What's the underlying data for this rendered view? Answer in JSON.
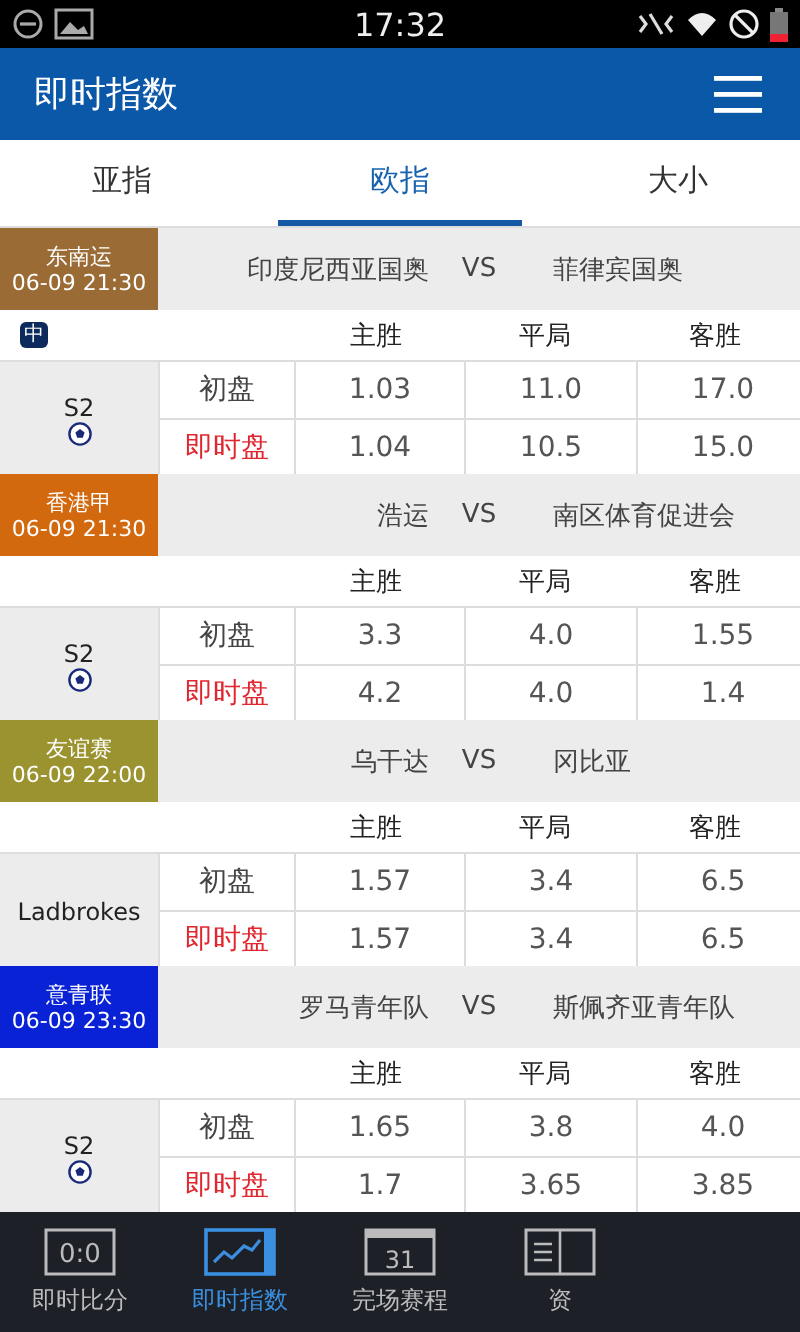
{
  "status_bar": {
    "time": "17:32"
  },
  "header": {
    "title": "即时指数"
  },
  "tabs": [
    {
      "label": "亚指",
      "selected": false
    },
    {
      "label": "欧指",
      "selected": true
    },
    {
      "label": "大小",
      "selected": false
    }
  ],
  "matches": [
    {
      "league": "东南运",
      "time": "06-09 21:30",
      "color": "#9a6b34",
      "home": "印度尼西亚国奥",
      "vs": "VS",
      "away": "菲律宾国奥",
      "badge": "中",
      "columns": [
        "主胜",
        "平局",
        "客胜"
      ],
      "bookmaker": {
        "name": "S2",
        "ball": true
      },
      "odds": [
        {
          "kind": "initial",
          "label": "初盘",
          "values": [
            "1.03",
            "11.0",
            "17.0"
          ]
        },
        {
          "kind": "live",
          "label": "即时盘",
          "values": [
            "1.04",
            "10.5",
            "15.0"
          ]
        }
      ]
    },
    {
      "league": "香港甲",
      "time": "06-09 21:30",
      "color": "#d2690f",
      "home": "浩运",
      "vs": "VS",
      "away": "南区体育促进会",
      "columns": [
        "主胜",
        "平局",
        "客胜"
      ],
      "bookmaker": {
        "name": "S2",
        "ball": true
      },
      "odds": [
        {
          "kind": "initial",
          "label": "初盘",
          "values": [
            "3.3",
            "4.0",
            "1.55"
          ]
        },
        {
          "kind": "live",
          "label": "即时盘",
          "values": [
            "4.2",
            "4.0",
            "1.4"
          ]
        }
      ]
    },
    {
      "league": "友谊赛",
      "time": "06-09 22:00",
      "color": "#9a9330",
      "home": "乌干达",
      "vs": "VS",
      "away": "冈比亚",
      "columns": [
        "主胜",
        "平局",
        "客胜"
      ],
      "bookmaker": {
        "name": "Ladbrokes",
        "ball": false
      },
      "odds": [
        {
          "kind": "initial",
          "label": "初盘",
          "values": [
            "1.57",
            "3.4",
            "6.5"
          ]
        },
        {
          "kind": "live",
          "label": "即时盘",
          "values": [
            "1.57",
            "3.4",
            "6.5"
          ]
        }
      ]
    },
    {
      "league": "意青联",
      "time": "06-09 23:30",
      "color": "#0a22d6",
      "home": "罗马青年队",
      "vs": "VS",
      "away": "斯佩齐亚青年队",
      "columns": [
        "主胜",
        "平局",
        "客胜"
      ],
      "bookmaker": {
        "name": "S2",
        "ball": true
      },
      "odds": [
        {
          "kind": "initial",
          "label": "初盘",
          "values": [
            "1.65",
            "3.8",
            "4.0"
          ]
        },
        {
          "kind": "live",
          "label": "即时盘",
          "values": [
            "1.7",
            "3.65",
            "3.85"
          ]
        }
      ]
    }
  ],
  "bottom_nav": [
    {
      "kind": "score",
      "label": "即时比分",
      "icon_text": "0:0",
      "selected": false
    },
    {
      "kind": "chart",
      "label": "即时指数",
      "selected": true
    },
    {
      "kind": "calendar",
      "label": "完场赛程",
      "icon_text": "31",
      "selected": false
    },
    {
      "kind": "info",
      "label": "资",
      "selected": false
    }
  ]
}
